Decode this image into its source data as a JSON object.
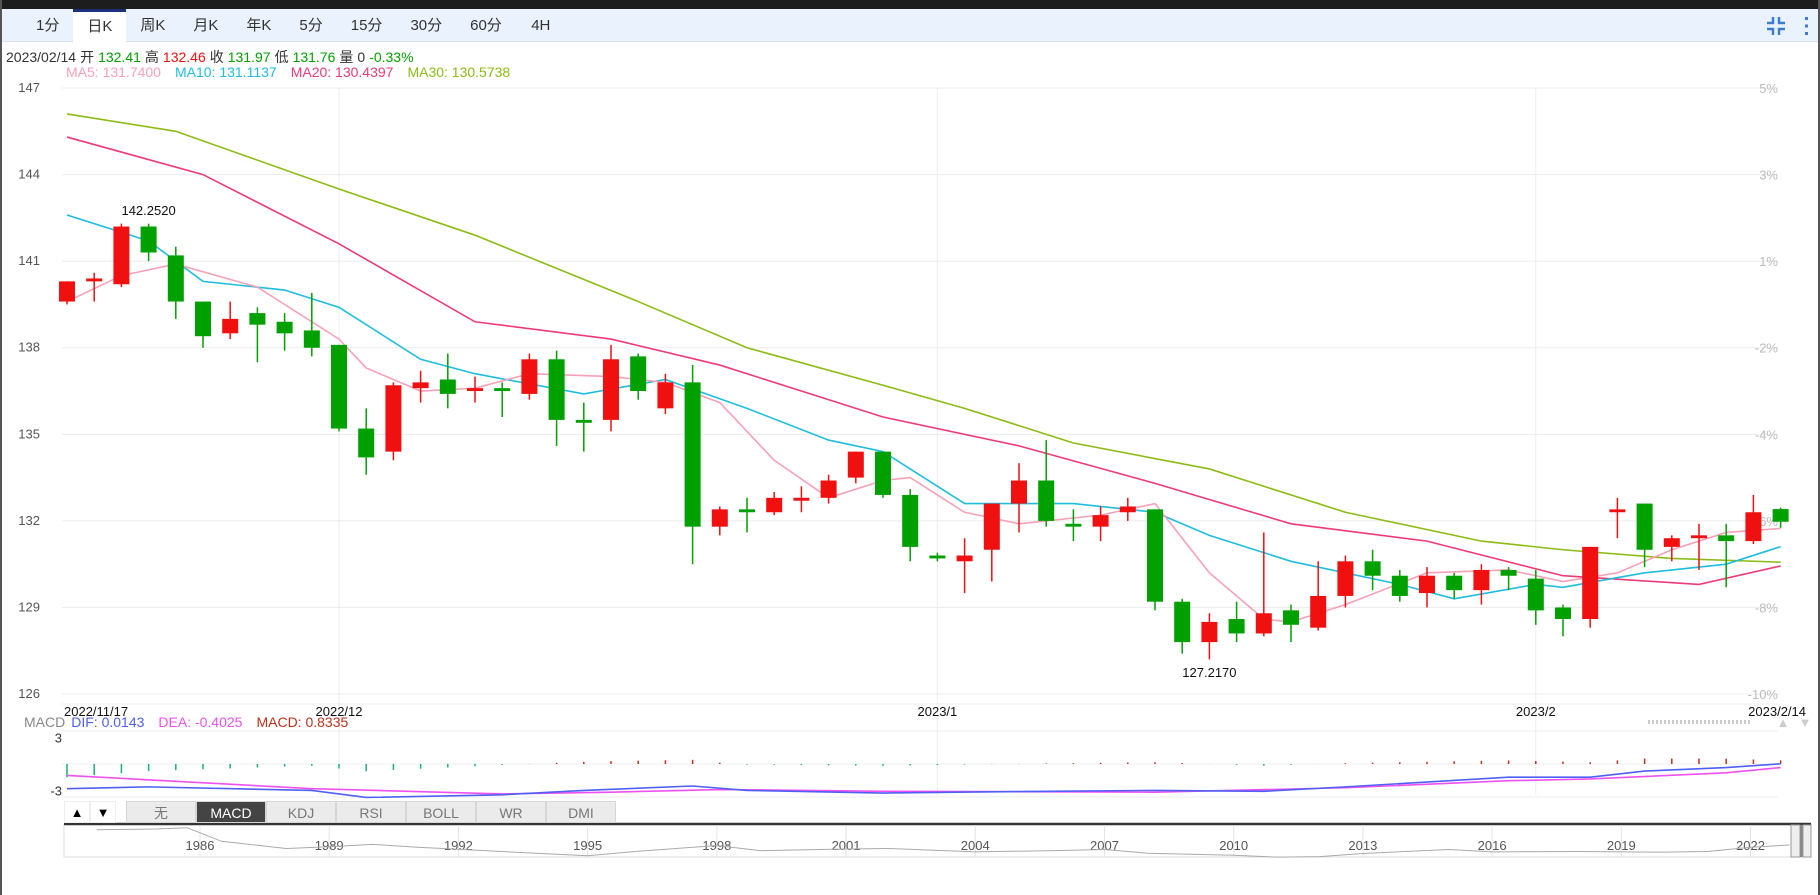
{
  "tabs": [
    "1分",
    "日K",
    "周K",
    "月K",
    "年K",
    "5分",
    "15分",
    "30分",
    "60分",
    "4H"
  ],
  "active_tab": 1,
  "icons": {
    "compress": "compress-icon",
    "more": "more-vertical-icon"
  },
  "info": {
    "date": "2023/02/14",
    "open_label": "开",
    "open": "132.41",
    "high_label": "高",
    "high": "132.46",
    "close_label": "收",
    "close": "131.97",
    "low_label": "低",
    "low": "131.76",
    "vol_label": "量",
    "vol": "0",
    "change": "-0.33%"
  },
  "ma_legend": {
    "ma5": "MA5: 131.7400",
    "ma10": "MA10: 131.1137",
    "ma20": "MA20: 130.4397",
    "ma30": "MA30: 130.5738"
  },
  "macd_legend": {
    "title": "MACD",
    "dif": "DIF: 0.0143",
    "dea": "DEA: -0.4025",
    "macd": "MACD: 0.8335"
  },
  "indicators": [
    "无",
    "MACD",
    "KDJ",
    "RSI",
    "BOLL",
    "WR",
    "DMI"
  ],
  "active_indicator": 1,
  "colors": {
    "up": "#f01010",
    "down": "#00a000",
    "ma5": "#f7a1b8",
    "ma10": "#1ebde0",
    "ma20": "#ee3b74",
    "ma30": "#8cbc14",
    "dif": "#4f60f5",
    "dea": "#f050f0",
    "hist_up": "#c0301a",
    "hist_down": "#17b07a"
  },
  "chart_data": {
    "type": "candlestick",
    "y_ticks": [
      "147",
      "144",
      "141",
      "138",
      "135",
      "132",
      "129",
      "126"
    ],
    "pct_ticks": [
      "5%",
      "3%",
      "1%",
      "-2%",
      "-4%",
      "-6%",
      "-8%",
      "-10%"
    ],
    "ylim": [
      126,
      147
    ],
    "x_labels": [
      {
        "i": 0,
        "text": "2022/11/17"
      },
      {
        "i": 10,
        "text": "2022/12"
      },
      {
        "i": 32,
        "text": "2023/1"
      },
      {
        "i": 54,
        "text": "2023/2"
      },
      {
        "i": 63,
        "text": "2023/2/14"
      }
    ],
    "high_mark": {
      "i": 3,
      "text": "142.2520"
    },
    "low_mark": {
      "i": 42,
      "text": "127.2170"
    },
    "candles": [
      [
        139.6,
        140.3,
        139.5,
        140.3
      ],
      [
        140.3,
        140.6,
        139.6,
        140.4
      ],
      [
        140.2,
        142.3,
        140.1,
        142.2
      ],
      [
        142.2,
        142.3,
        141.0,
        141.3
      ],
      [
        141.2,
        141.5,
        139.0,
        139.6
      ],
      [
        139.6,
        139.6,
        138.0,
        138.4
      ],
      [
        138.5,
        139.6,
        138.3,
        139.0
      ],
      [
        139.2,
        139.4,
        137.5,
        138.8
      ],
      [
        138.9,
        139.2,
        137.9,
        138.5
      ],
      [
        138.6,
        139.9,
        137.7,
        138.0
      ],
      [
        138.1,
        138.1,
        135.1,
        135.2
      ],
      [
        135.2,
        135.9,
        133.6,
        134.2
      ],
      [
        134.4,
        136.8,
        134.1,
        136.7
      ],
      [
        136.6,
        137.2,
        136.1,
        136.8
      ],
      [
        136.9,
        137.8,
        135.9,
        136.4
      ],
      [
        136.5,
        137.0,
        136.1,
        136.6
      ],
      [
        136.6,
        136.8,
        135.6,
        136.5
      ],
      [
        136.4,
        137.8,
        136.2,
        137.6
      ],
      [
        137.6,
        137.9,
        134.6,
        135.5
      ],
      [
        135.5,
        136.1,
        134.4,
        135.4
      ],
      [
        135.5,
        138.1,
        135.1,
        137.6
      ],
      [
        137.7,
        137.8,
        136.2,
        136.5
      ],
      [
        135.9,
        137.1,
        135.7,
        136.8
      ],
      [
        136.8,
        137.4,
        130.5,
        131.8
      ],
      [
        131.8,
        132.5,
        131.5,
        132.4
      ],
      [
        132.4,
        132.8,
        131.6,
        132.3
      ],
      [
        132.3,
        133.0,
        132.2,
        132.8
      ],
      [
        132.7,
        133.2,
        132.3,
        132.8
      ],
      [
        132.8,
        133.6,
        132.6,
        133.4
      ],
      [
        133.5,
        134.4,
        133.3,
        134.4
      ],
      [
        134.4,
        134.4,
        132.8,
        132.9
      ],
      [
        132.9,
        133.1,
        130.6,
        131.1
      ],
      [
        130.8,
        130.9,
        130.6,
        130.7
      ],
      [
        130.6,
        131.4,
        129.5,
        130.8
      ],
      [
        131.0,
        132.6,
        129.9,
        132.6
      ],
      [
        132.6,
        134.0,
        131.6,
        133.4
      ],
      [
        133.4,
        134.8,
        131.8,
        132.0
      ],
      [
        131.9,
        132.4,
        131.3,
        131.8
      ],
      [
        131.8,
        132.5,
        131.3,
        132.2
      ],
      [
        132.3,
        132.8,
        132.0,
        132.5
      ],
      [
        132.4,
        132.4,
        128.9,
        129.2
      ],
      [
        129.2,
        129.3,
        127.4,
        127.8
      ],
      [
        127.8,
        128.8,
        127.2,
        128.5
      ],
      [
        128.6,
        129.2,
        127.8,
        128.1
      ],
      [
        128.1,
        131.6,
        128.0,
        128.8
      ],
      [
        128.9,
        129.1,
        127.8,
        128.4
      ],
      [
        128.3,
        130.6,
        128.2,
        129.4
      ],
      [
        129.4,
        130.8,
        129.0,
        130.6
      ],
      [
        130.6,
        131.0,
        129.6,
        130.1
      ],
      [
        130.1,
        130.3,
        129.2,
        129.4
      ],
      [
        129.5,
        130.4,
        129.0,
        130.1
      ],
      [
        130.1,
        130.2,
        129.3,
        129.6
      ],
      [
        129.6,
        130.5,
        129.1,
        130.3
      ],
      [
        130.3,
        130.4,
        129.6,
        130.1
      ],
      [
        130.0,
        130.3,
        128.4,
        128.9
      ],
      [
        129.0,
        129.1,
        128.0,
        128.6
      ],
      [
        128.6,
        131.1,
        128.3,
        131.1
      ],
      [
        132.3,
        132.8,
        131.4,
        132.4
      ],
      [
        132.6,
        132.6,
        130.4,
        131.0
      ],
      [
        131.1,
        131.5,
        130.6,
        131.4
      ],
      [
        131.4,
        131.9,
        130.3,
        131.5
      ],
      [
        131.5,
        131.9,
        129.7,
        131.3
      ],
      [
        131.3,
        132.9,
        131.2,
        132.3
      ],
      [
        132.41,
        132.46,
        131.76,
        131.97
      ]
    ],
    "ma5": [
      [
        0,
        139.6
      ],
      [
        2,
        140.5
      ],
      [
        4,
        140.9
      ],
      [
        7,
        140.1
      ],
      [
        10,
        138.3
      ],
      [
        11,
        137.3
      ],
      [
        13,
        136.5
      ],
      [
        15,
        136.6
      ],
      [
        17,
        137.1
      ],
      [
        20,
        137.0
      ],
      [
        22,
        136.8
      ],
      [
        24,
        136.1
      ],
      [
        26,
        134.1
      ],
      [
        28,
        132.8
      ],
      [
        30,
        133.4
      ],
      [
        31,
        133.5
      ],
      [
        33,
        132.3
      ],
      [
        35,
        131.9
      ],
      [
        38,
        132.2
      ],
      [
        40,
        132.6
      ],
      [
        42,
        130.2
      ],
      [
        44,
        128.6
      ],
      [
        45,
        128.5
      ],
      [
        47,
        129.1
      ],
      [
        50,
        130.2
      ],
      [
        53,
        130.3
      ],
      [
        55,
        129.9
      ],
      [
        57,
        130.2
      ],
      [
        59,
        131.0
      ],
      [
        61,
        131.6
      ],
      [
        63,
        131.74
      ]
    ],
    "ma10": [
      [
        0,
        142.6
      ],
      [
        3,
        141.7
      ],
      [
        5,
        140.3
      ],
      [
        8,
        140.0
      ],
      [
        10,
        139.4
      ],
      [
        13,
        137.6
      ],
      [
        15,
        137.1
      ],
      [
        19,
        136.4
      ],
      [
        22,
        136.9
      ],
      [
        25,
        135.9
      ],
      [
        28,
        134.8
      ],
      [
        30,
        134.4
      ],
      [
        33,
        132.6
      ],
      [
        37,
        132.6
      ],
      [
        40,
        132.3
      ],
      [
        42,
        131.5
      ],
      [
        45,
        130.6
      ],
      [
        49,
        129.8
      ],
      [
        51,
        129.3
      ],
      [
        54,
        129.8
      ],
      [
        55,
        129.7
      ],
      [
        58,
        130.2
      ],
      [
        61,
        130.5
      ],
      [
        63,
        131.11
      ]
    ],
    "ma20": [
      [
        0,
        145.3
      ],
      [
        5,
        144.0
      ],
      [
        10,
        141.6
      ],
      [
        15,
        138.9
      ],
      [
        20,
        138.3
      ],
      [
        24,
        137.4
      ],
      [
        30,
        135.6
      ],
      [
        35,
        134.6
      ],
      [
        40,
        133.3
      ],
      [
        45,
        131.9
      ],
      [
        50,
        131.3
      ],
      [
        55,
        130.1
      ],
      [
        60,
        129.8
      ],
      [
        63,
        130.44
      ]
    ],
    "ma30": [
      [
        0,
        146.1
      ],
      [
        4,
        145.5
      ],
      [
        10,
        143.5
      ],
      [
        15,
        141.9
      ],
      [
        21,
        139.6
      ],
      [
        25,
        138.0
      ],
      [
        30,
        136.7
      ],
      [
        33,
        135.9
      ],
      [
        37,
        134.7
      ],
      [
        42,
        133.8
      ],
      [
        47,
        132.3
      ],
      [
        52,
        131.3
      ],
      [
        55,
        131.0
      ],
      [
        59,
        130.7
      ],
      [
        63,
        130.57
      ]
    ],
    "macd": {
      "ylim": [
        -3,
        3
      ],
      "y_ticks": [
        "3",
        "-3"
      ],
      "dif": [
        [
          0,
          -2.8
        ],
        [
          3,
          -2.6
        ],
        [
          9,
          -3.0
        ],
        [
          11,
          -3.8
        ],
        [
          16,
          -3.5
        ],
        [
          19,
          -3.0
        ],
        [
          23,
          -2.5
        ],
        [
          25,
          -3.0
        ],
        [
          30,
          -3.3
        ],
        [
          36,
          -3.1
        ],
        [
          40,
          -3.0
        ],
        [
          44,
          -3.1
        ],
        [
          47,
          -2.6
        ],
        [
          53,
          -1.5
        ],
        [
          56,
          -1.5
        ],
        [
          58,
          -0.8
        ],
        [
          61,
          -0.4
        ],
        [
          63,
          0.0143
        ]
      ],
      "dea": [
        [
          0,
          -1.3
        ],
        [
          9,
          -2.8
        ],
        [
          16,
          -3.4
        ],
        [
          20,
          -3.2
        ],
        [
          24,
          -2.9
        ],
        [
          30,
          -3.1
        ],
        [
          40,
          -3.2
        ],
        [
          47,
          -2.7
        ],
        [
          53,
          -1.9
        ],
        [
          56,
          -1.7
        ],
        [
          61,
          -1.0
        ],
        [
          63,
          -0.4025
        ]
      ]
    },
    "navigator": {
      "years": [
        "1986",
        "1989",
        "1992",
        "1995",
        "1998",
        "2001",
        "2004",
        "2007",
        "2010",
        "2013",
        "2016",
        "2019",
        "2022"
      ],
      "series": [
        [
          1983.6,
          238
        ],
        [
          1985,
          242
        ],
        [
          1985.7,
          250
        ],
        [
          1986.5,
          170
        ],
        [
          1988,
          128
        ],
        [
          1989,
          138
        ],
        [
          1990,
          152
        ],
        [
          1991,
          136
        ],
        [
          1993,
          110
        ],
        [
          1995,
          85
        ],
        [
          1996,
          108
        ],
        [
          1998,
          145
        ],
        [
          1999,
          115
        ],
        [
          2001,
          125
        ],
        [
          2002,
          128
        ],
        [
          2004,
          108
        ],
        [
          2006,
          116
        ],
        [
          2007,
          122
        ],
        [
          2008,
          100
        ],
        [
          2010,
          88
        ],
        [
          2011,
          77
        ],
        [
          2012,
          80
        ],
        [
          2013,
          98
        ],
        [
          2015,
          122
        ],
        [
          2016,
          108
        ],
        [
          2018,
          110
        ],
        [
          2020,
          106
        ],
        [
          2021,
          110
        ],
        [
          2022,
          135
        ],
        [
          2022.9,
          148
        ]
      ]
    }
  }
}
